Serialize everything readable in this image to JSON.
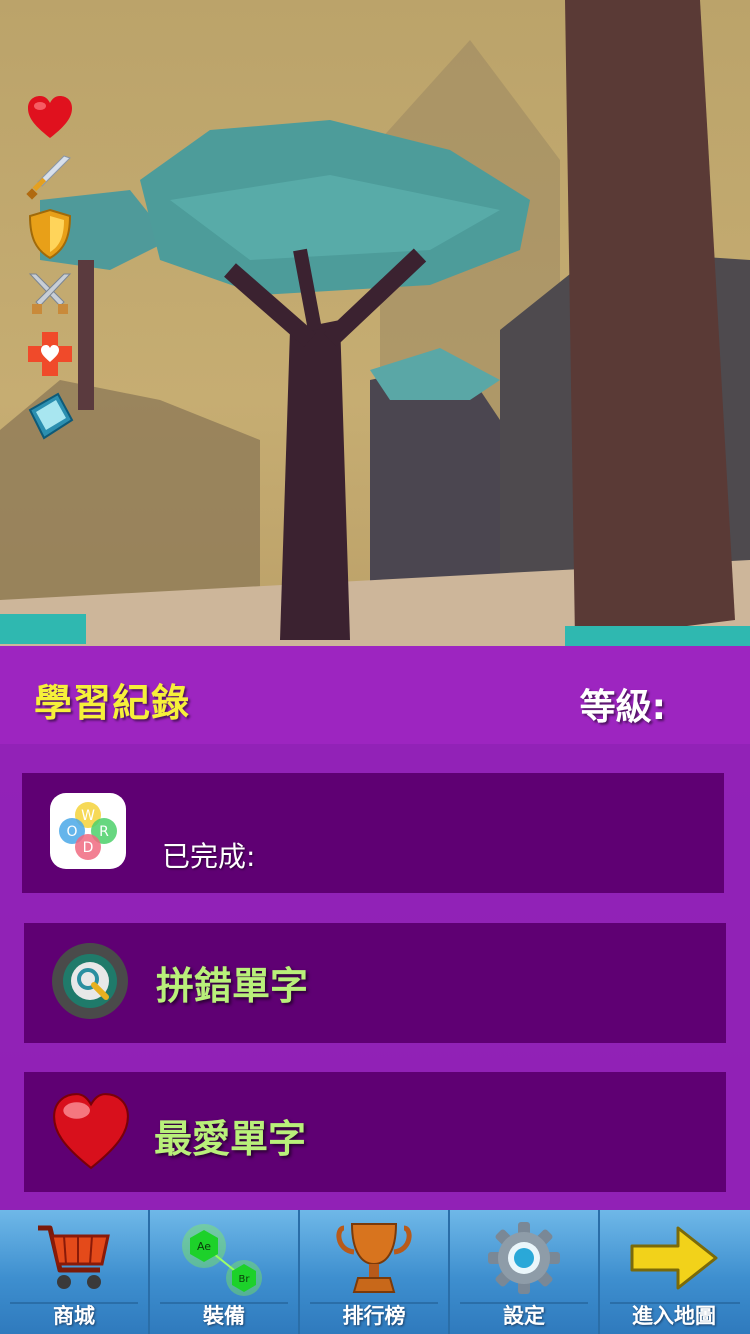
{
  "status_icons": [
    "heart-icon",
    "sword-icon",
    "shield-icon",
    "crossed-swords-icon",
    "heal-cross-icon",
    "spellbook-icon"
  ],
  "header": {
    "title": "學習紀錄",
    "level_label": "等級:"
  },
  "cards": {
    "progress": {
      "icon": "word-app-icon",
      "label": "已完成:"
    },
    "mistakes": {
      "icon": "target-magnifier-icon",
      "label": "拼錯單字"
    },
    "favorites": {
      "icon": "heart-icon",
      "label": "最愛單字"
    }
  },
  "nav": {
    "items": [
      {
        "icon": "cart-icon",
        "label": "商城"
      },
      {
        "icon": "gem-icon",
        "label": "裝備"
      },
      {
        "icon": "trophy-icon",
        "label": "排行榜"
      },
      {
        "icon": "gear-icon",
        "label": "設定"
      },
      {
        "icon": "arrow-right-icon",
        "label": "進入地圖"
      }
    ]
  },
  "colors": {
    "panel": "#8e18be",
    "card": "#5f0073",
    "title": "#f6f03a",
    "card_label": "#b9f07a",
    "nav": "#3e8fcf"
  }
}
